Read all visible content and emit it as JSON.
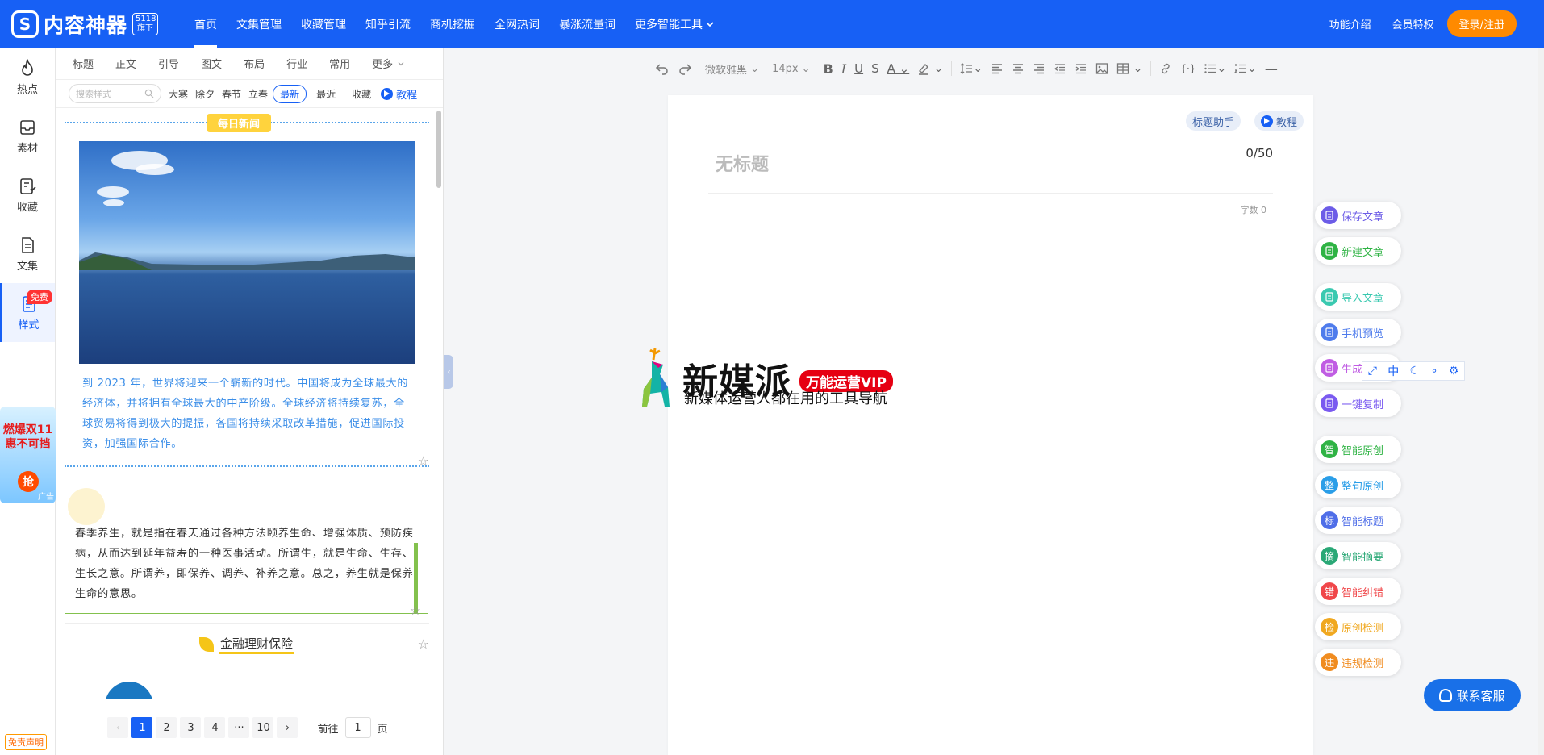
{
  "header": {
    "logo_icon": "S",
    "logo_text": "内容神器",
    "logo_badge_line1": "5118",
    "logo_badge_line2": "旗下",
    "nav": [
      {
        "label": "首页",
        "active": true
      },
      {
        "label": "文集管理"
      },
      {
        "label": "收藏管理"
      },
      {
        "label": "知乎引流"
      },
      {
        "label": "商机挖掘"
      },
      {
        "label": "全网热词"
      },
      {
        "label": "暴涨流量词"
      },
      {
        "label": "更多智能工具"
      }
    ],
    "right_links": [
      "功能介绍",
      "会员特权"
    ],
    "login_label": "登录/注册"
  },
  "left_sidebar": {
    "items": [
      {
        "label": "热点",
        "icon": "flame-icon"
      },
      {
        "label": "素材",
        "icon": "inbox-icon"
      },
      {
        "label": "收藏",
        "icon": "bookmark-icon"
      },
      {
        "label": "文集",
        "icon": "document-icon"
      },
      {
        "label": "样式",
        "icon": "list-icon",
        "active": true,
        "badge": "免费"
      }
    ],
    "ad_line1": "燃爆双11",
    "ad_line2": "惠不可挡",
    "ad_button": "抢",
    "ad_tag": "广告",
    "disclaimer": "免责声明"
  },
  "style_panel": {
    "tabs": [
      "标题",
      "正文",
      "引导",
      "图文",
      "布局",
      "行业",
      "常用",
      "更多"
    ],
    "search_placeholder": "搜索样式",
    "filters": [
      "大寒",
      "除夕",
      "春节",
      "立春"
    ],
    "sort_options": [
      "最新",
      "最近",
      "收藏"
    ],
    "sort_selected": "最新",
    "tutorial_label": "教程",
    "card1": {
      "tag": "每日新闻",
      "text": "到 2023 年，世界将迎来一个崭新的时代。中国将成为全球最大的经济体，并将拥有全球最大的中产阶级。全球经济将持续复苏，全球贸易将得到极大的提振，各国将持续采取改革措施，促进国际投资，加强国际合作。"
    },
    "card2": {
      "text": "春季养生，就是指在春天通过各种方法颐养生命、增强体质、预防疾病，从而达到延年益寿的一种医事活动。所谓生，就是生命、生存、生长之意。所谓养，即保养、调养、补养之意。总之，养生就是保养生命的意思。"
    },
    "card3": {
      "title": "金融理财保险"
    },
    "pagination": {
      "pages": [
        "1",
        "2",
        "3",
        "4",
        "···",
        "10"
      ],
      "current": "1",
      "goto_prefix": "前往",
      "goto_value": "1",
      "goto_suffix": "页"
    }
  },
  "toolbar": {
    "font_family": "微软雅黑",
    "font_size": "14px"
  },
  "editor": {
    "title_placeholder": "无标题",
    "title_count": "0/50",
    "word_count": "字数 0",
    "title_helper": "标题助手",
    "tutorial": "教程"
  },
  "watermark": {
    "main": "新媒派",
    "vip": "万能运营VIP",
    "sub": "新媒体运营人都在用的工具导航"
  },
  "right_actions": [
    {
      "label": "保存文章",
      "icon_text": "",
      "color": "#6c5ce7"
    },
    {
      "label": "新建文章",
      "icon_text": "",
      "color": "#2fb344"
    },
    {
      "label": "导入文章",
      "icon_text": "",
      "color": "#3ac9b0"
    },
    {
      "label": "手机预览",
      "icon_text": "",
      "color": "#4f7cec"
    },
    {
      "label": "生成长图",
      "icon_text": "",
      "color": "#c05de3"
    },
    {
      "label": "一键复制",
      "icon_text": "",
      "color": "#7a5af0"
    },
    {
      "label": "智能原创",
      "icon_text": "智",
      "color": "#2fb344"
    },
    {
      "label": "整句原创",
      "icon_text": "整",
      "color": "#2a9ee8"
    },
    {
      "label": "智能标题",
      "icon_text": "标",
      "color": "#4f6ee8"
    },
    {
      "label": "智能摘要",
      "icon_text": "摘",
      "color": "#2aa876"
    },
    {
      "label": "智能纠错",
      "icon_text": "错",
      "color": "#f0474a"
    },
    {
      "label": "原创检测",
      "icon_text": "检",
      "color": "#f0a820"
    },
    {
      "label": "违规检测",
      "icon_text": "违",
      "color": "#f08c20"
    }
  ],
  "mini_tools": [
    "中"
  ],
  "customer_service": "联系客服"
}
